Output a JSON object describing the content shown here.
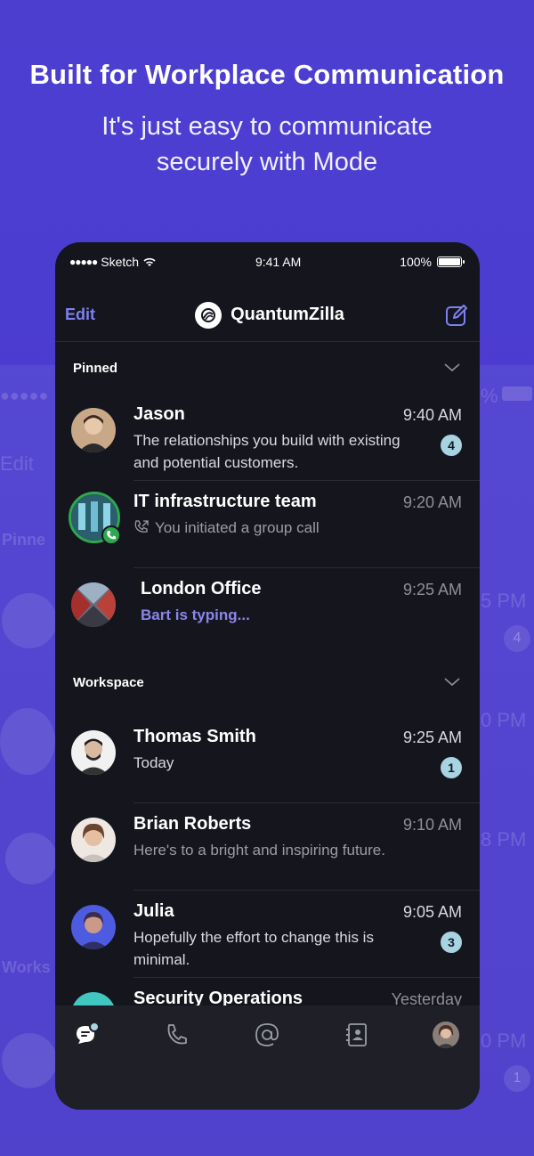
{
  "promo": {
    "headline": "Built for Workplace Communication",
    "subline_1": "It's just easy to communicate",
    "subline_2": "securely with Mode"
  },
  "ghost": {
    "edit": "Edit",
    "pinned": "Pinne",
    "works": "Works",
    "time_1": "5 PM",
    "time_2": "0 PM",
    "time_3": "8 PM",
    "time_4": "0 PM",
    "badge_1": "4",
    "badge_2": "1",
    "percent": "%"
  },
  "status_bar": {
    "carrier": "Sketch",
    "time": "9:41 AM",
    "battery": "100%"
  },
  "nav": {
    "edit_label": "Edit",
    "workspace_name": "QuantumZilla"
  },
  "sections": {
    "pinned": "Pinned",
    "workspace": "Workspace"
  },
  "pinned_chats": [
    {
      "name": "Jason",
      "time": "9:40 AM",
      "message": "The relationships you build with existing and potential customers.",
      "badge": "4"
    },
    {
      "name": "IT infrastructure team",
      "time": "9:20 AM",
      "message": "You initiated a group call"
    },
    {
      "name": "London Office",
      "time": "9:25 AM",
      "message": "Bart is typing..."
    }
  ],
  "workspace_chats": [
    {
      "name": "Thomas Smith",
      "time": "9:25 AM",
      "message": "Today",
      "badge": "1"
    },
    {
      "name": "Brian Roberts",
      "time": "9:10 AM",
      "message": "Here's to a bright and inspiring future."
    },
    {
      "name": "Julia",
      "time": "9:05 AM",
      "message": "Hopefully the effort to change this is minimal.",
      "badge": "3"
    },
    {
      "name": "Security Operations",
      "time": "Yesterday",
      "message": ""
    }
  ],
  "tabs": [
    "chats-icon",
    "phone-icon",
    "mentions-icon",
    "contacts-icon",
    "profile-avatar"
  ],
  "colors": {
    "background": "#4a3bcf",
    "accent": "#7c80f2",
    "badge": "#a8d3e0",
    "call_green": "#2fa84f"
  }
}
